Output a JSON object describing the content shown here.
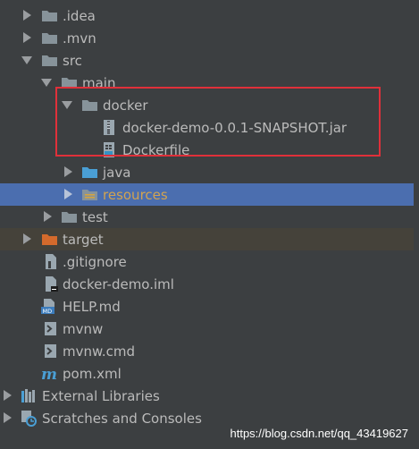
{
  "tree": {
    "items": [
      {
        "label": ".idea",
        "icon": "folder-icon"
      },
      {
        "label": ".mvn",
        "icon": "folder-icon"
      },
      {
        "label": "src",
        "icon": "folder-icon"
      },
      {
        "label": "main",
        "icon": "folder-icon"
      },
      {
        "label": "docker",
        "icon": "folder-icon"
      },
      {
        "label": "docker-demo-0.0.1-SNAPSHOT.jar",
        "icon": "jar-file-icon"
      },
      {
        "label": "Dockerfile",
        "icon": "dockerfile-icon"
      },
      {
        "label": "java",
        "icon": "source-folder-icon"
      },
      {
        "label": "resources",
        "icon": "resources-folder-icon"
      },
      {
        "label": "test",
        "icon": "folder-icon"
      },
      {
        "label": "target",
        "icon": "excluded-folder-icon"
      },
      {
        "label": ".gitignore",
        "icon": "gitignore-file-icon"
      },
      {
        "label": "docker-demo.iml",
        "icon": "iml-file-icon"
      },
      {
        "label": "HELP.md",
        "icon": "markdown-file-icon"
      },
      {
        "label": "mvnw",
        "icon": "script-file-icon"
      },
      {
        "label": "mvnw.cmd",
        "icon": "cmd-file-icon"
      },
      {
        "label": "pom.xml",
        "icon": "maven-pom-icon"
      },
      {
        "label": "External Libraries",
        "icon": "libraries-icon"
      },
      {
        "label": "Scratches and Consoles",
        "icon": "scratches-icon"
      }
    ]
  },
  "watermark": "https://blog.csdn.net/qq_43419627",
  "colors": {
    "background": "#3c3f41",
    "selection": "#4b6eaf",
    "folder": "#87939a",
    "source_folder": "#4a9fd5",
    "excluded_folder": "#d46a2c",
    "highlight_box": "#e0303a"
  }
}
